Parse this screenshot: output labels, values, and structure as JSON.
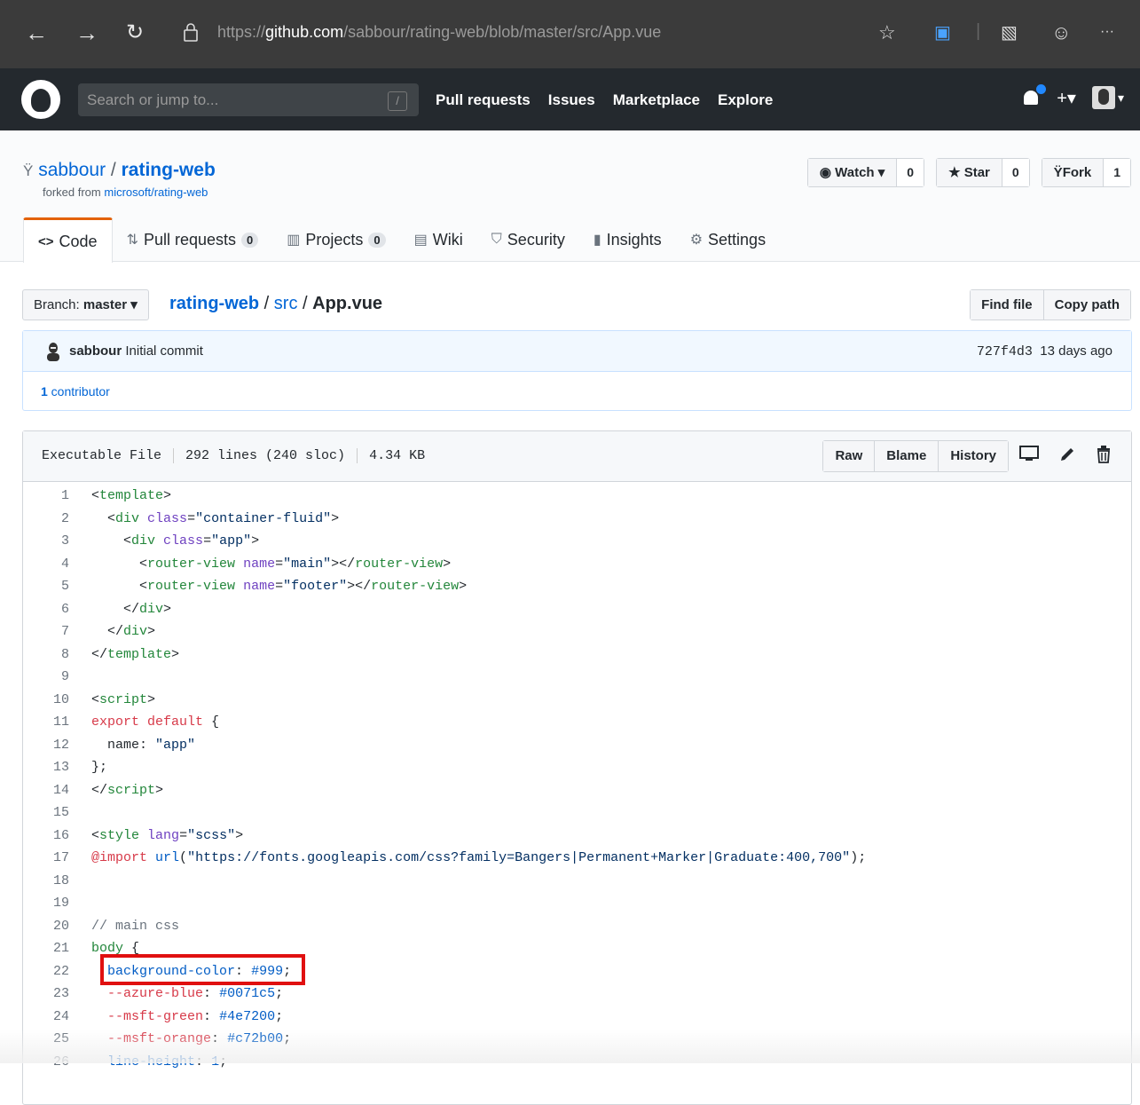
{
  "browser": {
    "url_prefix": "https://",
    "url_host": "github.com",
    "url_path": "/sabbour/rating-web/blob/master/src/App.vue",
    "more": "···"
  },
  "header": {
    "search_placeholder": "Search or jump to...",
    "search_hint": "/",
    "nav": [
      "Pull requests",
      "Issues",
      "Marketplace",
      "Explore"
    ],
    "plus": "+▾",
    "avatar_caret": "▾"
  },
  "repo": {
    "owner": "sabbour",
    "separator": "/",
    "name": "rating-web",
    "forked_from_label": "forked from ",
    "forked_from": "microsoft/rating-web",
    "watch_label": "Watch ▾",
    "watch_count": "0",
    "star_label": "Star",
    "star_count": "0",
    "fork_label": "Fork",
    "fork_count": "1"
  },
  "tabs": [
    {
      "label": "Code",
      "icon": "<>"
    },
    {
      "label": "Pull requests",
      "icon": "⇅",
      "count": "0"
    },
    {
      "label": "Projects",
      "icon": "▥",
      "count": "0"
    },
    {
      "label": "Wiki",
      "icon": "▤"
    },
    {
      "label": "Security",
      "icon": "⛉"
    },
    {
      "label": "Insights",
      "icon": "▮"
    },
    {
      "label": "Settings",
      "icon": "⚙"
    }
  ],
  "breadcrumb": {
    "branch_label": "Branch: ",
    "branch": "master ▾",
    "root": "rating-web",
    "sep1": " / ",
    "dir": "src",
    "sep2": " / ",
    "file": "App.vue",
    "find_file": "Find file",
    "copy_path": "Copy path"
  },
  "commit": {
    "author": "sabbour",
    "message": " Initial commit",
    "sha": "727f4d3",
    "time": "13 days ago",
    "contributors_count": "1",
    "contributors_label": " contributor"
  },
  "file": {
    "mode": "Executable File",
    "lines": "292 lines (240 sloc)",
    "size": "4.34 KB",
    "raw": "Raw",
    "blame": "Blame",
    "history": "History"
  },
  "code_lines": [
    [
      [
        "t-base",
        "<"
      ],
      [
        "t-tag",
        "template"
      ],
      [
        "t-base",
        ">"
      ]
    ],
    [
      [
        "t-base",
        "  <"
      ],
      [
        "t-tag",
        "div"
      ],
      [
        "t-base",
        " "
      ],
      [
        "t-attr",
        "class"
      ],
      [
        "t-base",
        "="
      ],
      [
        "t-str",
        "\"container-fluid\""
      ],
      [
        "t-base",
        ">"
      ]
    ],
    [
      [
        "t-base",
        "    <"
      ],
      [
        "t-tag",
        "div"
      ],
      [
        "t-base",
        " "
      ],
      [
        "t-attr",
        "class"
      ],
      [
        "t-base",
        "="
      ],
      [
        "t-str",
        "\"app\""
      ],
      [
        "t-base",
        ">"
      ]
    ],
    [
      [
        "t-base",
        "      <"
      ],
      [
        "t-tag",
        "router-view"
      ],
      [
        "t-base",
        " "
      ],
      [
        "t-attr",
        "name"
      ],
      [
        "t-base",
        "="
      ],
      [
        "t-str",
        "\"main\""
      ],
      [
        "t-base",
        "></"
      ],
      [
        "t-tag",
        "router-view"
      ],
      [
        "t-base",
        ">"
      ]
    ],
    [
      [
        "t-base",
        "      <"
      ],
      [
        "t-tag",
        "router-view"
      ],
      [
        "t-base",
        " "
      ],
      [
        "t-attr",
        "name"
      ],
      [
        "t-base",
        "="
      ],
      [
        "t-str",
        "\"footer\""
      ],
      [
        "t-base",
        "></"
      ],
      [
        "t-tag",
        "router-view"
      ],
      [
        "t-base",
        ">"
      ]
    ],
    [
      [
        "t-base",
        "    </"
      ],
      [
        "t-tag",
        "div"
      ],
      [
        "t-base",
        ">"
      ]
    ],
    [
      [
        "t-base",
        "  </"
      ],
      [
        "t-tag",
        "div"
      ],
      [
        "t-base",
        ">"
      ]
    ],
    [
      [
        "t-base",
        "</"
      ],
      [
        "t-tag",
        "template"
      ],
      [
        "t-base",
        ">"
      ]
    ],
    [],
    [
      [
        "t-base",
        "<"
      ],
      [
        "t-tag",
        "script"
      ],
      [
        "t-base",
        ">"
      ]
    ],
    [
      [
        "t-kw",
        "export"
      ],
      [
        "t-base",
        " "
      ],
      [
        "t-kw",
        "default"
      ],
      [
        "t-base",
        " {"
      ]
    ],
    [
      [
        "t-base",
        "  name: "
      ],
      [
        "t-str",
        "\"app\""
      ]
    ],
    [
      [
        "t-base",
        "};"
      ]
    ],
    [
      [
        "t-base",
        "</"
      ],
      [
        "t-tag",
        "script"
      ],
      [
        "t-base",
        ">"
      ]
    ],
    [],
    [
      [
        "t-base",
        "<"
      ],
      [
        "t-tag",
        "style"
      ],
      [
        "t-base",
        " "
      ],
      [
        "t-attr",
        "lang"
      ],
      [
        "t-base",
        "="
      ],
      [
        "t-str",
        "\"scss\""
      ],
      [
        "t-base",
        ">"
      ]
    ],
    [
      [
        "t-kw",
        "@import"
      ],
      [
        "t-base",
        " "
      ],
      [
        "t-ent",
        "url"
      ],
      [
        "t-base",
        "("
      ],
      [
        "t-str",
        "\"https://fonts.googleapis.com/css?family=Bangers|Permanent+Marker|Graduate:400,700\""
      ],
      [
        "t-base",
        ");"
      ]
    ],
    [],
    [],
    [
      [
        "t-cm",
        "// main css"
      ]
    ],
    [
      [
        "t-tag",
        "body"
      ],
      [
        "t-base",
        " {"
      ]
    ],
    [
      [
        "t-base",
        "  "
      ],
      [
        "t-ent",
        "background-color"
      ],
      [
        "t-base",
        ": "
      ],
      [
        "t-ent",
        "#999"
      ],
      [
        "t-base",
        ";"
      ]
    ],
    [
      [
        "t-base",
        "  "
      ],
      [
        "t-kw",
        "--azure-blue"
      ],
      [
        "t-base",
        ": "
      ],
      [
        "t-ent",
        "#0071c5"
      ],
      [
        "t-base",
        ";"
      ]
    ],
    [
      [
        "t-base",
        "  "
      ],
      [
        "t-kw",
        "--msft-green"
      ],
      [
        "t-base",
        ": "
      ],
      [
        "t-ent",
        "#4e7200"
      ],
      [
        "t-base",
        ";"
      ]
    ],
    [
      [
        "t-base",
        "  "
      ],
      [
        "t-kw",
        "--msft-orange"
      ],
      [
        "t-base",
        ": "
      ],
      [
        "t-ent",
        "#c72b00"
      ],
      [
        "t-base",
        ";"
      ]
    ],
    [
      [
        "t-base",
        "  "
      ],
      [
        "t-ent",
        "line-height"
      ],
      [
        "t-base",
        ": "
      ],
      [
        "t-ent",
        "1"
      ],
      [
        "t-base",
        ";"
      ]
    ]
  ],
  "line_numbers": [
    "1",
    "2",
    "3",
    "4",
    "5",
    "6",
    "7",
    "8",
    "9",
    "10",
    "11",
    "12",
    "13",
    "14",
    "15",
    "16",
    "17",
    "18",
    "19",
    "20",
    "21",
    "22",
    "23",
    "24",
    "25",
    "26"
  ]
}
